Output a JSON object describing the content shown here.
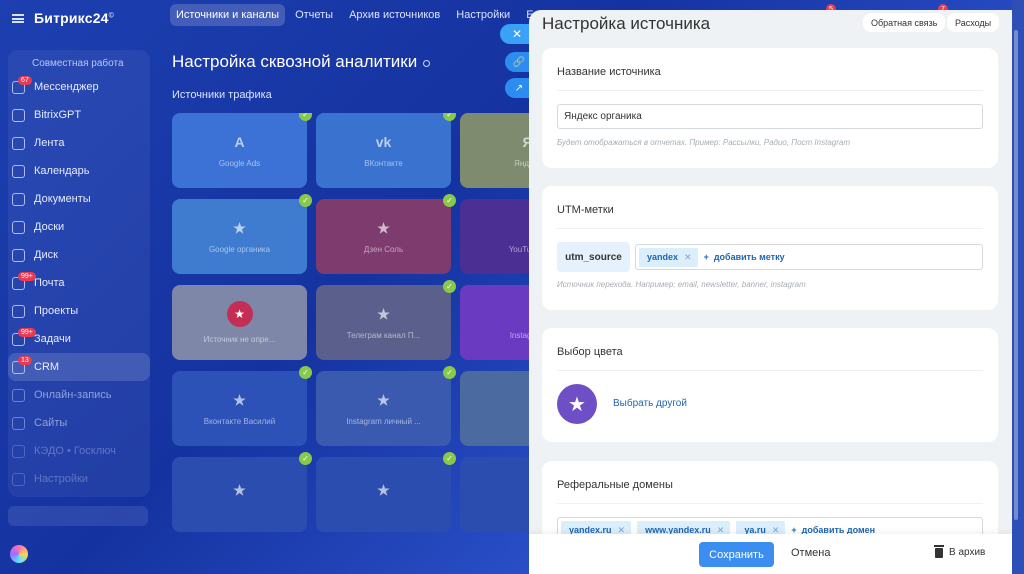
{
  "app": {
    "logo": "Битрикс24",
    "logo_mark": "©"
  },
  "topnav": [
    "Источники и каналы",
    "Отчеты",
    "Архив источников",
    "Настройки",
    "Ещ"
  ],
  "top_badges": [
    "5",
    "7"
  ],
  "sidebar": {
    "group_title": "Совместная работа",
    "items": [
      {
        "label": "Мессенджер",
        "badge": "67"
      },
      {
        "label": "BitrixGPT",
        "badge": ""
      },
      {
        "label": "Лента",
        "badge": ""
      },
      {
        "label": "Календарь",
        "badge": ""
      },
      {
        "label": "Документы",
        "badge": ""
      },
      {
        "label": "Доски",
        "badge": ""
      },
      {
        "label": "Диск",
        "badge": ""
      },
      {
        "label": "Почта",
        "badge": "99+"
      },
      {
        "label": "Проекты",
        "badge": ""
      },
      {
        "label": "Задачи",
        "badge": "99+"
      },
      {
        "label": "CRM",
        "badge": "13"
      },
      {
        "label": "Онлайн-запись",
        "badge": ""
      },
      {
        "label": "Сайты",
        "badge": ""
      },
      {
        "label": "КЭДО • Госключ",
        "badge": ""
      },
      {
        "label": "Настройки",
        "badge": ""
      }
    ]
  },
  "page": {
    "title": "Настройка сквозной аналитики",
    "section": "Источники трафика"
  },
  "tiles": [
    {
      "label": "Google Ads",
      "icon": "A",
      "color": "#3c72d6",
      "checked": true
    },
    {
      "label": "ВКонтакте",
      "icon": "vk",
      "color": "#3a72d0",
      "checked": true
    },
    {
      "label": "Яндекс",
      "icon": "Я",
      "color": "#7f8b6e",
      "checked": true
    },
    {
      "label": "Google органика",
      "icon": "★",
      "color": "#3f7ccf",
      "checked": true
    },
    {
      "label": "Дзен Соль",
      "icon": "★",
      "color": "#7d3b6e",
      "checked": true
    },
    {
      "label": "YouTube-к",
      "icon": "",
      "color": "#4b2f93",
      "checked": true
    },
    {
      "label": "Источник не опре...",
      "icon": "★",
      "color": "#7f87a8",
      "checked": false
    },
    {
      "label": "Телеграм канал П...",
      "icon": "★",
      "color": "#5a5f8c",
      "checked": true
    },
    {
      "label": "Instagram",
      "icon": "",
      "color": "#6a3bc0",
      "checked": true
    },
    {
      "label": "Вконтакте Василий",
      "icon": "★",
      "color": "#2c52b8",
      "checked": true
    },
    {
      "label": "Instagram личный ...",
      "icon": "★",
      "color": "#3a5ab0",
      "checked": true
    },
    {
      "label": "",
      "icon": "",
      "color": "#4a6aa0",
      "checked": true
    },
    {
      "label": "",
      "icon": "★",
      "color": "#2b4db0",
      "checked": true
    },
    {
      "label": "",
      "icon": "★",
      "color": "#2b4db0",
      "checked": true
    },
    {
      "label": "",
      "icon": "",
      "color": "#2b4db0",
      "checked": false
    }
  ],
  "panel": {
    "title": "Настройка источника",
    "feedback": "Обратная связь",
    "expenses": "Расходы",
    "name_section": {
      "title": "Название источника",
      "value": "Яндекс органика",
      "hint": "Будет отображаться в отчетах. Пример: Рассылки, Радио, Пост Instagram"
    },
    "utm_section": {
      "title": "UTM-метки",
      "key": "utm_source",
      "tags": [
        "yandex"
      ],
      "add_label": "добавить метку",
      "hint": "Источник перехода. Например: email, newsletter, banner, instagram"
    },
    "color_section": {
      "title": "Выбор цвета",
      "link": "Выбрать другой",
      "color": "#6e4fc5"
    },
    "domains_section": {
      "title": "Реферальные домены",
      "tags": [
        "yandex.ru",
        "www.yandex.ru",
        "ya.ru"
      ],
      "add_label": "добавить домен"
    },
    "footer": {
      "save": "Сохранить",
      "cancel": "Отмена",
      "archive": "В архив"
    }
  },
  "colors": {
    "accent": "#3b8ef0",
    "link": "#2067b0",
    "check": "#89c94a"
  }
}
